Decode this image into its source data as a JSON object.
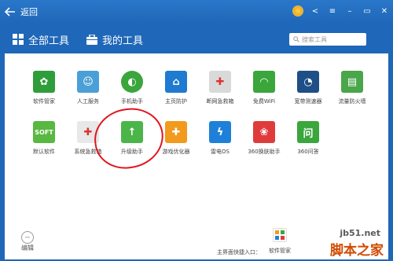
{
  "titlebar": {
    "back_label": "返回"
  },
  "header": {
    "tabs": [
      {
        "label": "全部工具"
      },
      {
        "label": "我的工具"
      }
    ],
    "search_placeholder": "搜索工具"
  },
  "tools": [
    {
      "label": "软件管家",
      "icon": "software-manager-icon",
      "color": "#2f9d3a"
    },
    {
      "label": "人工服务",
      "icon": "human-service-icon",
      "color": "#4aa0d6"
    },
    {
      "label": "手机助手",
      "icon": "phone-assistant-icon",
      "color": "#3aa63c"
    },
    {
      "label": "主页防护",
      "icon": "home-protect-icon",
      "color": "#1e7bd0"
    },
    {
      "label": "断网急救箱",
      "icon": "network-aid-icon",
      "color": "#d9d9d9"
    },
    {
      "label": "免费WiFi",
      "icon": "wifi-icon",
      "color": "#3aa63c"
    },
    {
      "label": "宽带测速器",
      "icon": "speedtest-icon",
      "color": "#1e4f86"
    },
    {
      "label": "流量防火墙",
      "icon": "firewall-icon",
      "color": "#4aa64a"
    },
    {
      "label": "默认软件",
      "icon": "default-software-icon",
      "color": "#58b840"
    },
    {
      "label": "系统急救箱",
      "icon": "system-aid-icon",
      "color": "#e8e8e8"
    },
    {
      "label": "升级助手",
      "icon": "upgrade-icon",
      "color": "#4bb54a"
    },
    {
      "label": "游戏优化器",
      "icon": "game-optimizer-icon",
      "color": "#f29a1e"
    },
    {
      "label": "雷电OS",
      "icon": "thunder-os-icon",
      "color": "#1e80d8"
    },
    {
      "label": "360换肤助手",
      "icon": "skin-icon",
      "color": "#e03b3b"
    },
    {
      "label": "360问答",
      "icon": "qa-icon",
      "color": "#3aa63c"
    }
  ],
  "bottom": {
    "edit_label": "编辑",
    "shortcut_label": "主界面快捷入口：",
    "manager_label": "软件管家"
  },
  "watermark": {
    "line1": "jb51.net",
    "line2": "脚本之家"
  }
}
